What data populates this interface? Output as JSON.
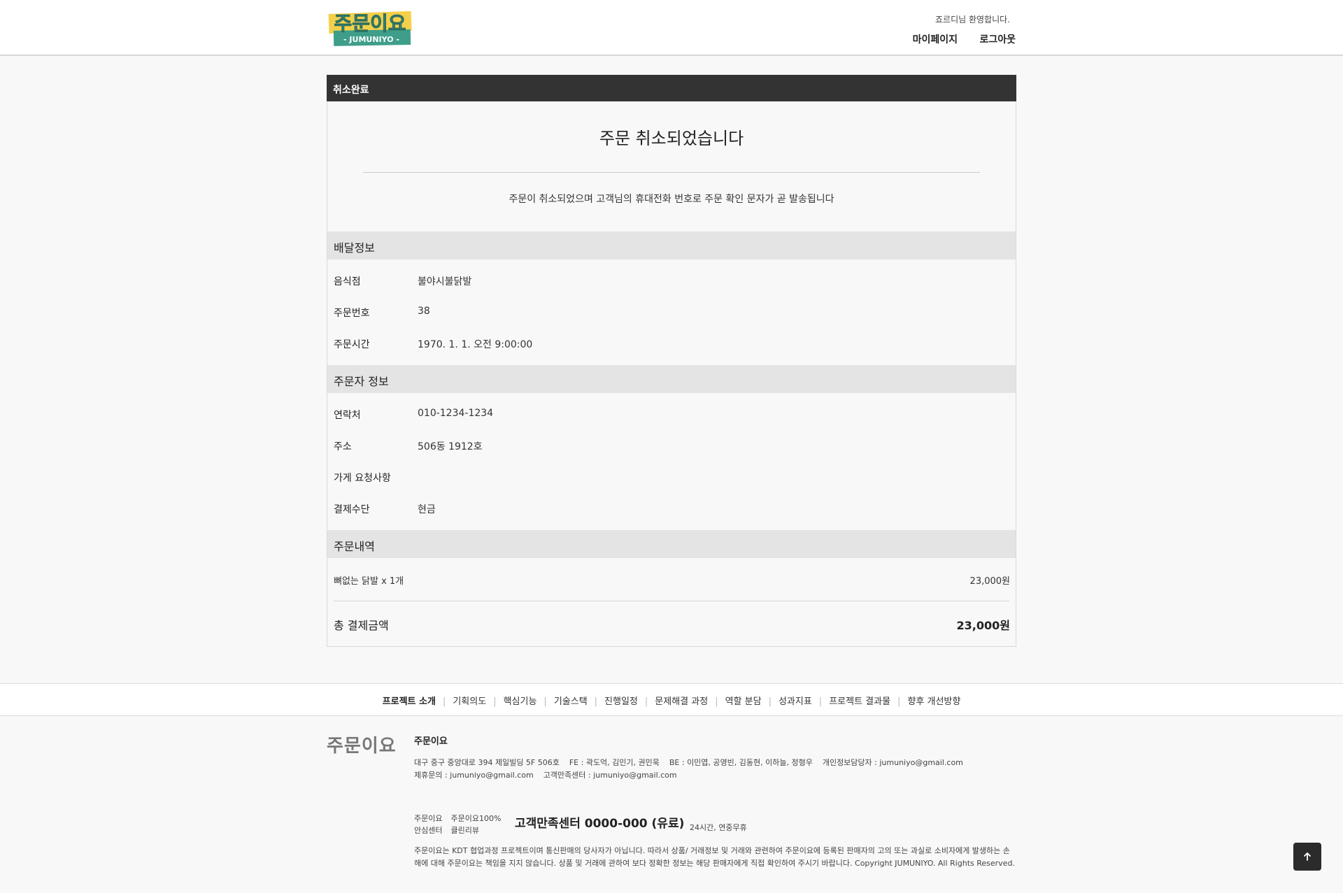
{
  "header": {
    "logo": {
      "line1": "주문이요",
      "line2": "- JUMUNIYO -"
    },
    "welcome": "죠르디님 환영합니다.",
    "mypage_label": "마이페이지",
    "logout_label": "로그아웃"
  },
  "card": {
    "header_label": "취소완료",
    "title": "주문 취소되었습니다",
    "message": "주문이 취소되었으며 고객님의 휴대전화 번호로 주문 확인 문자가 곧 발송됩니다",
    "delivery": {
      "section_title": "배달정보",
      "rows": [
        {
          "label": "음식점",
          "value": "불야시불닭발"
        },
        {
          "label": "주문번호",
          "value": "38"
        },
        {
          "label": "주문시간",
          "value": "1970. 1. 1. 오전 9:00:00"
        }
      ]
    },
    "orderer": {
      "section_title": "주문자 정보",
      "rows": [
        {
          "label": "연락처",
          "value": "010-1234-1234"
        },
        {
          "label": "주소",
          "value": "506동 1912호"
        },
        {
          "label": "가게 요청사항",
          "value": ""
        },
        {
          "label": "결제수단",
          "value": "현금"
        }
      ]
    },
    "order_items": {
      "section_title": "주문내역",
      "items": [
        {
          "name": "뼈없는 닭발 x 1개",
          "price": "23,000원"
        }
      ],
      "total_label": "총 결제금액",
      "total_value": "23,000원"
    }
  },
  "footer": {
    "nav": [
      "프로젝트 소개",
      "기획의도",
      "핵심기능",
      "기술스택",
      "진행일정",
      "문제해결 과정",
      "역할 분담",
      "성과지표",
      "프로젝트 결과물",
      "향후 개선방향"
    ],
    "logo_text": "주문이요",
    "company_name": "주문이요",
    "address_line": "대구 중구 중앙대로 394 제일빌딩 5F 506호    FE : 곽도억, 김민기, 권민욱    BE : 이민엽, 공영빈, 김동현, 이하늘, 정형우    개인정보담당자 : jumuniyo@gmail.com",
    "contact_line": "제휴문의 : jumuniyo@gmail.com    고객만족센터 : jumuniyo@gmail.com",
    "badges_row1": [
      "주문이요",
      "주문이요100%"
    ],
    "badges_row2": [
      "안심센터",
      "클린리뷰"
    ],
    "cs_phone": "고객만족센터 0000-000 (유료)",
    "cs_hours": "24시간, 연중무휴",
    "disclaimer": "주문이요는 KDT 협업과정 프로젝트이며 통신판매의 당사자가 아닙니다. 따라서 상품/ 거래정보 및 거래와 관련하여 주문이요에 등록된 판매자의 고의 또는 과실로 소비자에게 발생하는 손해에 대해 주문이요는 책임을 지지 않습니다. 상품 및 거래에 관하여 보다 정확한 정보는 해당 판매자에게 직접 확인하여 주시기 바랍니다. Copyright JUMUNIYO. All Rights Reserved."
  },
  "colors": {
    "logo_yellow": "#f4d04a",
    "logo_teal": "#3f9e8a",
    "card_header_bg": "#333333",
    "section_bg": "#e4e4e4"
  },
  "icons": {
    "scroll_top": "arrow-up-icon"
  }
}
